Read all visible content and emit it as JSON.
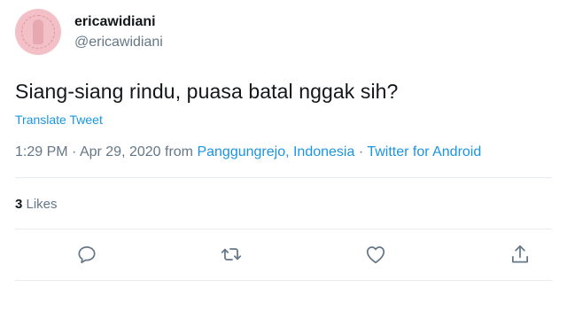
{
  "tweet": {
    "display_name": "ericawidiani",
    "handle": "@ericawidiani",
    "text": "Siang-siang rindu, puasa batal nggak sih?",
    "translate_label": "Translate Tweet",
    "time": "1:29 PM",
    "sep1": " · ",
    "date": "Apr 29, 2020",
    "from_word": " from ",
    "location": "Panggungrejo, Indonesia",
    "sep2": " · ",
    "source": "Twitter for Android",
    "likes_count": "3",
    "likes_label": " Likes"
  },
  "actions": [
    {
      "icon": "reply-icon"
    },
    {
      "icon": "retweet-icon"
    },
    {
      "icon": "like-icon"
    },
    {
      "icon": "share-icon"
    }
  ],
  "colors": {
    "link": "#1b95e0",
    "secondary_text": "#657786",
    "primary_text": "#14171a",
    "divider": "#e6ecf0"
  }
}
